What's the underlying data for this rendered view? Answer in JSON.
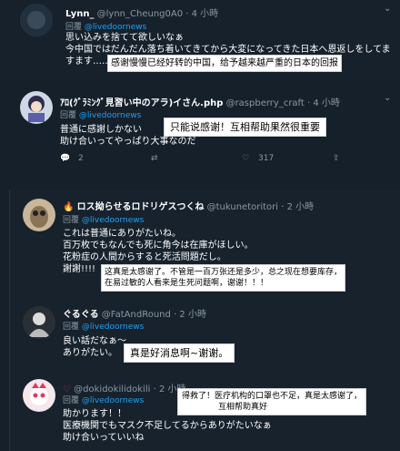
{
  "tweets": [
    {
      "name": "Lynn_",
      "handle": "@lynn_Cheung0A0",
      "time": "4 小時",
      "reply_prefix": "回覆",
      "reply_to": "@livedoornews",
      "lines": [
        "思い込みを捨てて欲しいなぁ",
        "今中国ではだんだん落ち着いてきてから大変になってきた日本へ恩返しをしてま",
        "すます……"
      ],
      "annotation": "感谢慢慢已经好转的中国，给予越来越严重的日本的回报"
    },
    {
      "name": "ｱﾛ(ｸﾞﾗﾐﾝｸﾞ見習い中のアラ)イさん.php",
      "handle": "@raspberry_craft",
      "time": "4 小時",
      "reply_prefix": "回覆",
      "reply_to": "@livedoornews",
      "lines": [
        "普通に感謝しかない",
        "助け合いってやっぱり大事なのだ"
      ],
      "annotation": "只能说感谢！互相帮助果然很重要",
      "actions": {
        "replies": "2",
        "likes": "317"
      }
    },
    {
      "name": "ロス拗らせるロドリゲスつくね",
      "handle": "@tukunetoritori",
      "time": "2 小時",
      "reply_prefix": "回覆",
      "reply_to": "@livedoornews",
      "lines": [
        "これは普通にありがたいね。",
        "百万枚でもなんでも死に角今は在庫がほしい。",
        "花粉症の人間からすると死活問題だし。",
        "謝謝!!!!"
      ],
      "annotation": [
        "这真是太感谢了。不管是一百万张还是多少，总之现在想要库存，",
        "在易过敏的人看来是生死问题啊，谢谢！！！"
      ]
    },
    {
      "name": "ぐるぐる",
      "handle": "@FatAndRound",
      "time": "2 小時",
      "reply_prefix": "回覆",
      "reply_to": "@livedoornews",
      "lines": [
        "良い話だなぁ～",
        "ありがたい。"
      ],
      "annotation": "真是好消息啊~谢谢。"
    },
    {
      "name": "",
      "handle": "@dokidokilidokili",
      "time": "2 小時",
      "reply_prefix": "回覆",
      "reply_to": "@livedoornews",
      "lines": [
        "助かります！！",
        "医療機関でもマスク不足してるからありがたいなぁ",
        "助け合いっていいね"
      ],
      "annotation": [
        "得救了！医疗机构的口罩也不足，真是太感谢了，",
        "互相帮助真好"
      ]
    }
  ],
  "icons": {
    "chevron": "chevron-down-icon",
    "reply": "reply-icon",
    "retweet": "retweet-icon",
    "like": "heart-icon",
    "share": "share-icon"
  },
  "colors": {
    "bg": "#15202b",
    "link": "#1da1f2",
    "muted": "#8899a6",
    "annotation_bg": "#ffffff"
  }
}
